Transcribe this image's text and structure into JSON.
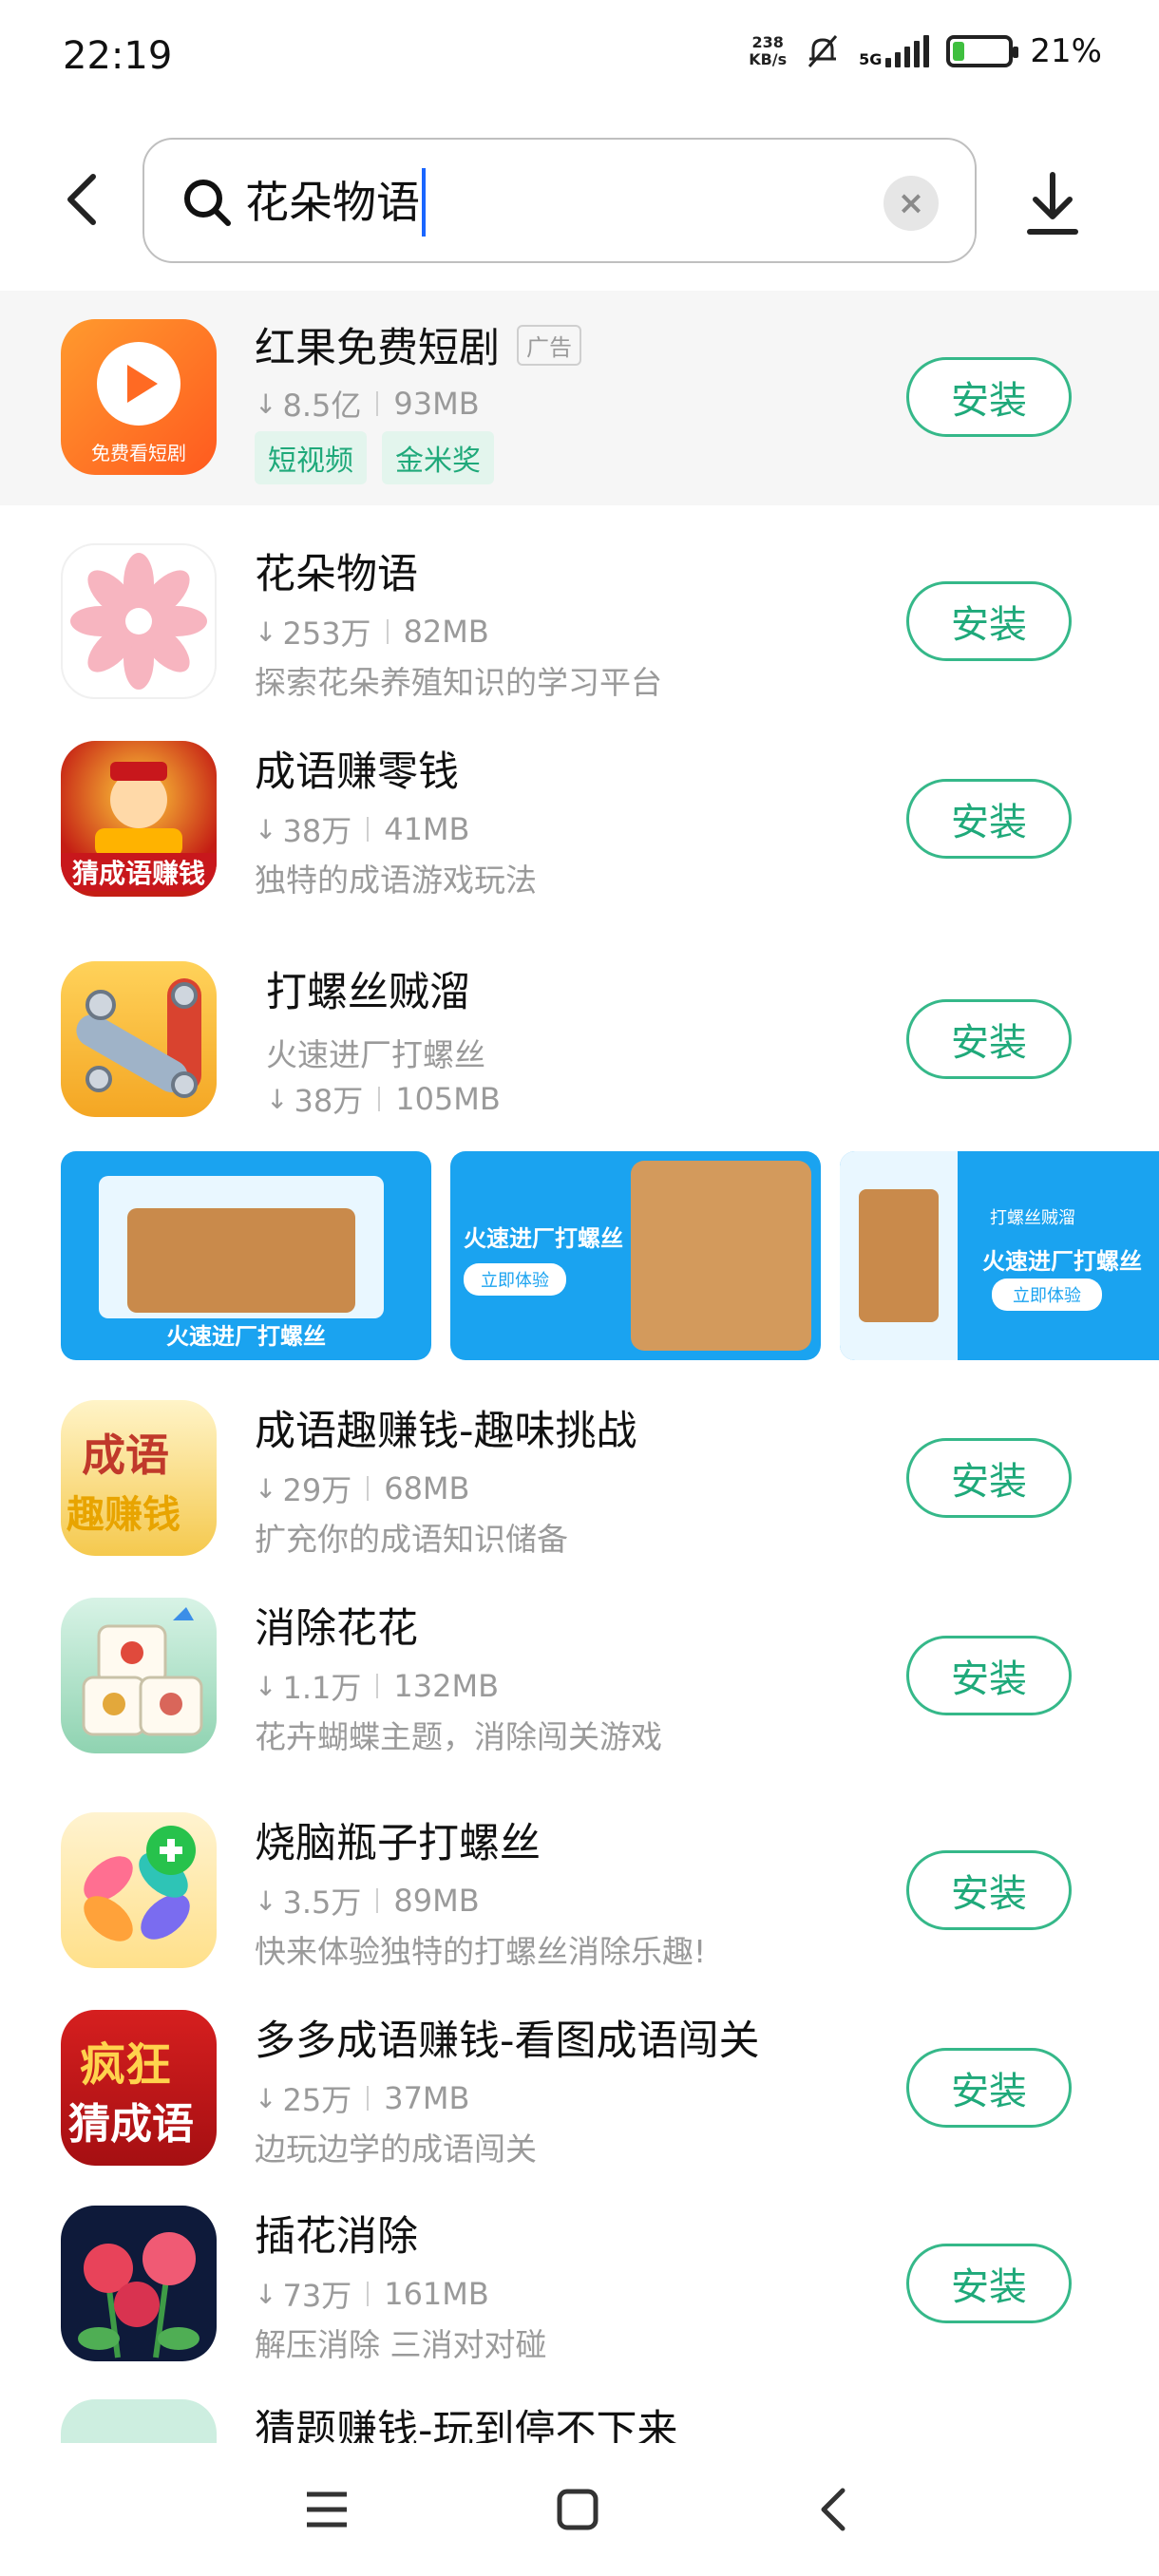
{
  "status_bar": {
    "time": "22:19",
    "net_speed_value": "238",
    "net_speed_unit": "KB/s",
    "network_type": "5G",
    "battery_percent": "21%",
    "battery_level": 0.21
  },
  "search": {
    "query": "花朵物语",
    "clear_icon": "close-icon"
  },
  "ad": {
    "name": "红果免费短剧",
    "badge": "广告",
    "downloads": "8.5亿",
    "size": "93MB",
    "tags": [
      "短视频",
      "金米奖"
    ],
    "icon_caption": "免费看短剧",
    "install_label": "安装"
  },
  "apps": [
    {
      "name": "花朵物语",
      "downloads": "253万",
      "size": "82MB",
      "desc": "探索花朵养殖知识的学习平台",
      "install_label": "安装"
    },
    {
      "name": "成语赚零钱",
      "downloads": "38万",
      "size": "41MB",
      "desc": "独特的成语游戏玩法",
      "icon_caption": "猜成语赚钱",
      "install_label": "安装"
    },
    {
      "name": "打螺丝贼溜",
      "desc": "火速进厂打螺丝",
      "downloads": "38万",
      "size": "105MB",
      "install_label": "安装"
    },
    {
      "name": "成语趣赚钱-趣味挑战",
      "downloads": "29万",
      "size": "68MB",
      "desc": "扩充你的成语知识储备",
      "icon_text_1": "成语",
      "icon_text_2": "趣赚钱",
      "install_label": "安装"
    },
    {
      "name": "消除花花",
      "downloads": "1.1万",
      "size": "132MB",
      "desc": "花卉蝴蝶主题，消除闯关游戏",
      "install_label": "安装"
    },
    {
      "name": "烧脑瓶子打螺丝",
      "downloads": "3.5万",
      "size": "89MB",
      "desc": "快来体验独特的打螺丝消除乐趣!",
      "install_label": "安装"
    },
    {
      "name": "多多成语赚钱-看图成语闯关",
      "downloads": "25万",
      "size": "37MB",
      "desc": "边玩边学的成语闯关",
      "icon_text_1": "疯狂",
      "icon_text_2": "猜成语",
      "install_label": "安装"
    },
    {
      "name": "插花消除",
      "downloads": "73万",
      "size": "161MB",
      "desc": "解压消除 三消对对碰",
      "install_label": "安装"
    },
    {
      "name": "猜题赚钱-玩到停不下来"
    }
  ],
  "banners": {
    "b1_caption": "火速进厂打螺丝",
    "b2_title": "火速进厂打螺丝",
    "b2_button": "立即体验",
    "b3_app": "打螺丝贼溜",
    "b3_title": "火速进厂打螺丝",
    "b3_button": "立即体验"
  },
  "colors": {
    "accent": "#1fa97a",
    "accent_border": "#35b889",
    "banner_blue": "#1aa3f0"
  }
}
